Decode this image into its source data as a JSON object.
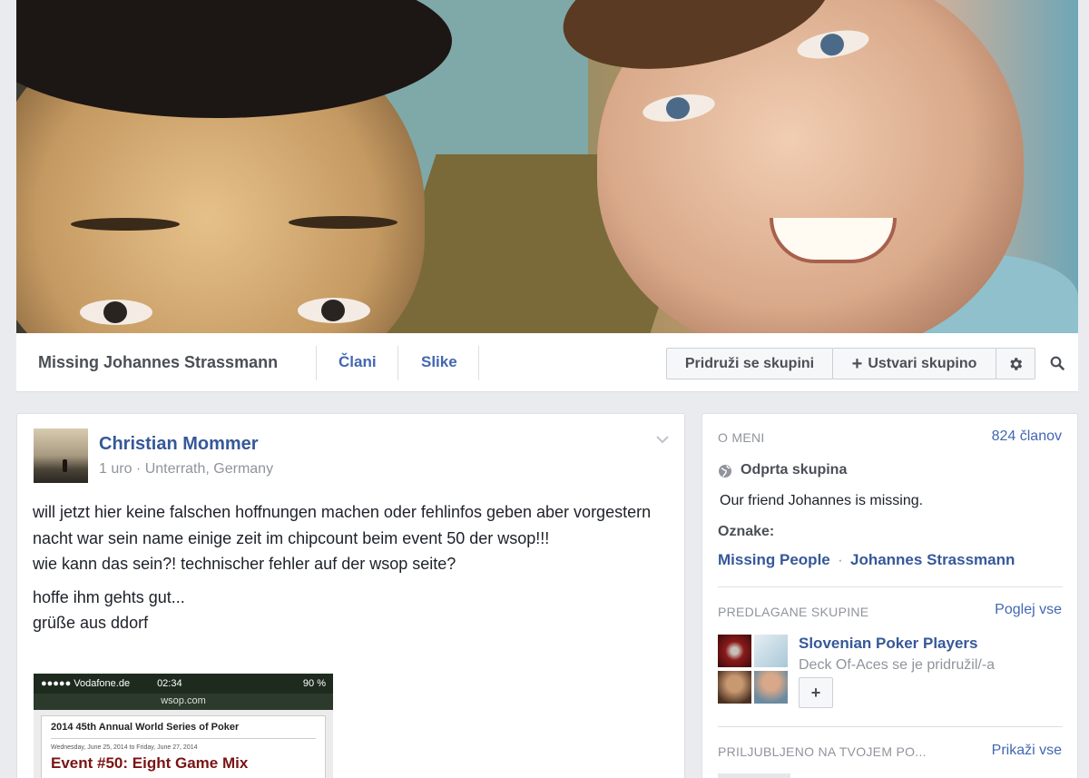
{
  "group": {
    "title": "Missing Johannes Strassmann",
    "tabs": [
      {
        "label": "Člani"
      },
      {
        "label": "Slike"
      }
    ],
    "join_label": "Pridruži se skupini",
    "create_label": "Ustvari skupino"
  },
  "post": {
    "author": "Christian Mommer",
    "meta": "1 uro · Unterrath, Germany",
    "paragraph1": "will jetzt hier keine falschen hoffnungen machen oder fehlinfos geben aber vorgestern nacht war sein name einige zeit im chipcount beim event 50 der wsop!!!",
    "paragraph1b": "wie kann das sein?! technischer fehler auf der wsop seite?",
    "paragraph2": "hoffe ihm gehts gut...",
    "paragraph2b": "grüße aus ddorf",
    "attachment": {
      "carrier": "●●●●● Vodafone.de",
      "time": "02:34",
      "battery": "90 %",
      "url": "wsop.com",
      "heading": "2014 45th Annual World Series of Poker",
      "dates": "Wednesday, June 25, 2014 to Friday, June 27, 2014",
      "event": "Event #50: Eight Game Mix"
    }
  },
  "sidebar": {
    "about_label": "O MENI",
    "members": "824 članov",
    "privacy": "Odprta skupina",
    "description": "Our friend Johannes is missing.",
    "tags_label": "Oznake:",
    "tags": [
      "Missing People",
      "Johannes Strassmann"
    ],
    "tag_separator": "·",
    "suggested_label": "PREDLAGANE SKUPINE",
    "see_all": "Poglej vse",
    "suggested_group": {
      "name": "Slovenian Poker Players",
      "activity": "Deck Of-Aces se je pridružil/-a",
      "add_label": "+"
    },
    "liked_label": "PRILJUBLJENO NA TVOJEM PO...",
    "show_label": "Prikaži vse"
  },
  "colors": {
    "link": "#4267b2",
    "author": "#365899",
    "background": "#e9ebee"
  }
}
